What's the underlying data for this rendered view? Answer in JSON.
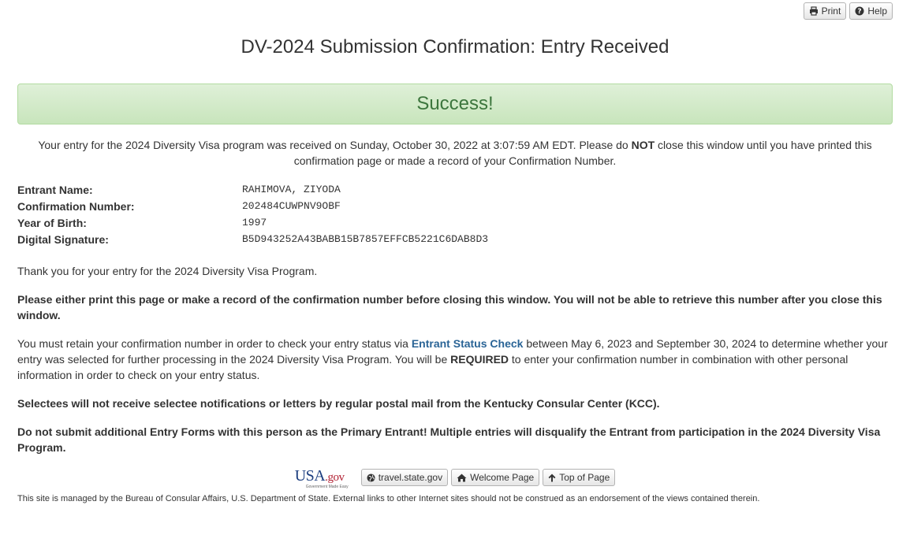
{
  "toolbar": {
    "print_label": "Print",
    "help_label": "Help"
  },
  "title": "DV-2024 Submission Confirmation: Entry Received",
  "success_banner": "Success!",
  "intro": {
    "before": "Your entry for the 2024 Diversity Visa program was received on Sunday, October 30, 2022 at 3:07:59 AM EDT. Please do ",
    "emphasis": "NOT",
    "after": " close this window until you have printed this confirmation page or made a record of your Confirmation Number."
  },
  "entry": [
    {
      "label": "Entrant Name:",
      "value": "RAHIMOVA, ZIYODA"
    },
    {
      "label": "Confirmation Number:",
      "value": "202484CUWPNV9OBF"
    },
    {
      "label": "Year of Birth:",
      "value": "1997"
    },
    {
      "label": "Digital Signature:",
      "value": "B5D943252A43BABB15B7857EFFCB5221C6DAB8D3"
    }
  ],
  "paragraphs": {
    "thank_you": "Thank you for your entry for the 2024 Diversity Visa Program.",
    "print_warning": "Please either print this page or make a record of the confirmation number before closing this window. You will not be able to retrieve this number after you close this window.",
    "retain_before": "You must retain your confirmation number in order to check your entry status via ",
    "retain_link": "Entrant Status Check",
    "retain_middle": " between May 6, 2023 and September 30, 2024 to determine whether your entry was selected for further processing in the 2024 Diversity Visa Program. You will be ",
    "retain_required": "REQUIRED",
    "retain_after": " to enter your confirmation number in combination with other personal information in order to check on your entry status.",
    "no_mail": "Selectees will not receive selectee notifications or letters by regular postal mail from the Kentucky Consular Center (KCC).",
    "no_duplicates": "Do not submit additional Entry Forms with this person as the Primary Entrant! Multiple entries will disqualify the Entrant from participation in the 2024 Diversity Visa Program."
  },
  "footer": {
    "logo_text": "USA",
    "logo_suffix": ".gov",
    "logo_tagline": "Government Made Easy",
    "travel_label": "travel.state.gov",
    "welcome_label": "Welcome Page",
    "top_label": "Top of Page",
    "disclaimer": "This site is managed by the Bureau of Consular Affairs, U.S. Department of State. External links to other Internet sites should not be construed as an endorsement of the views contained therein."
  },
  "colors": {
    "success_text": "#3c763d",
    "success_bg": "#dff0d8",
    "link": "#2a6496"
  }
}
